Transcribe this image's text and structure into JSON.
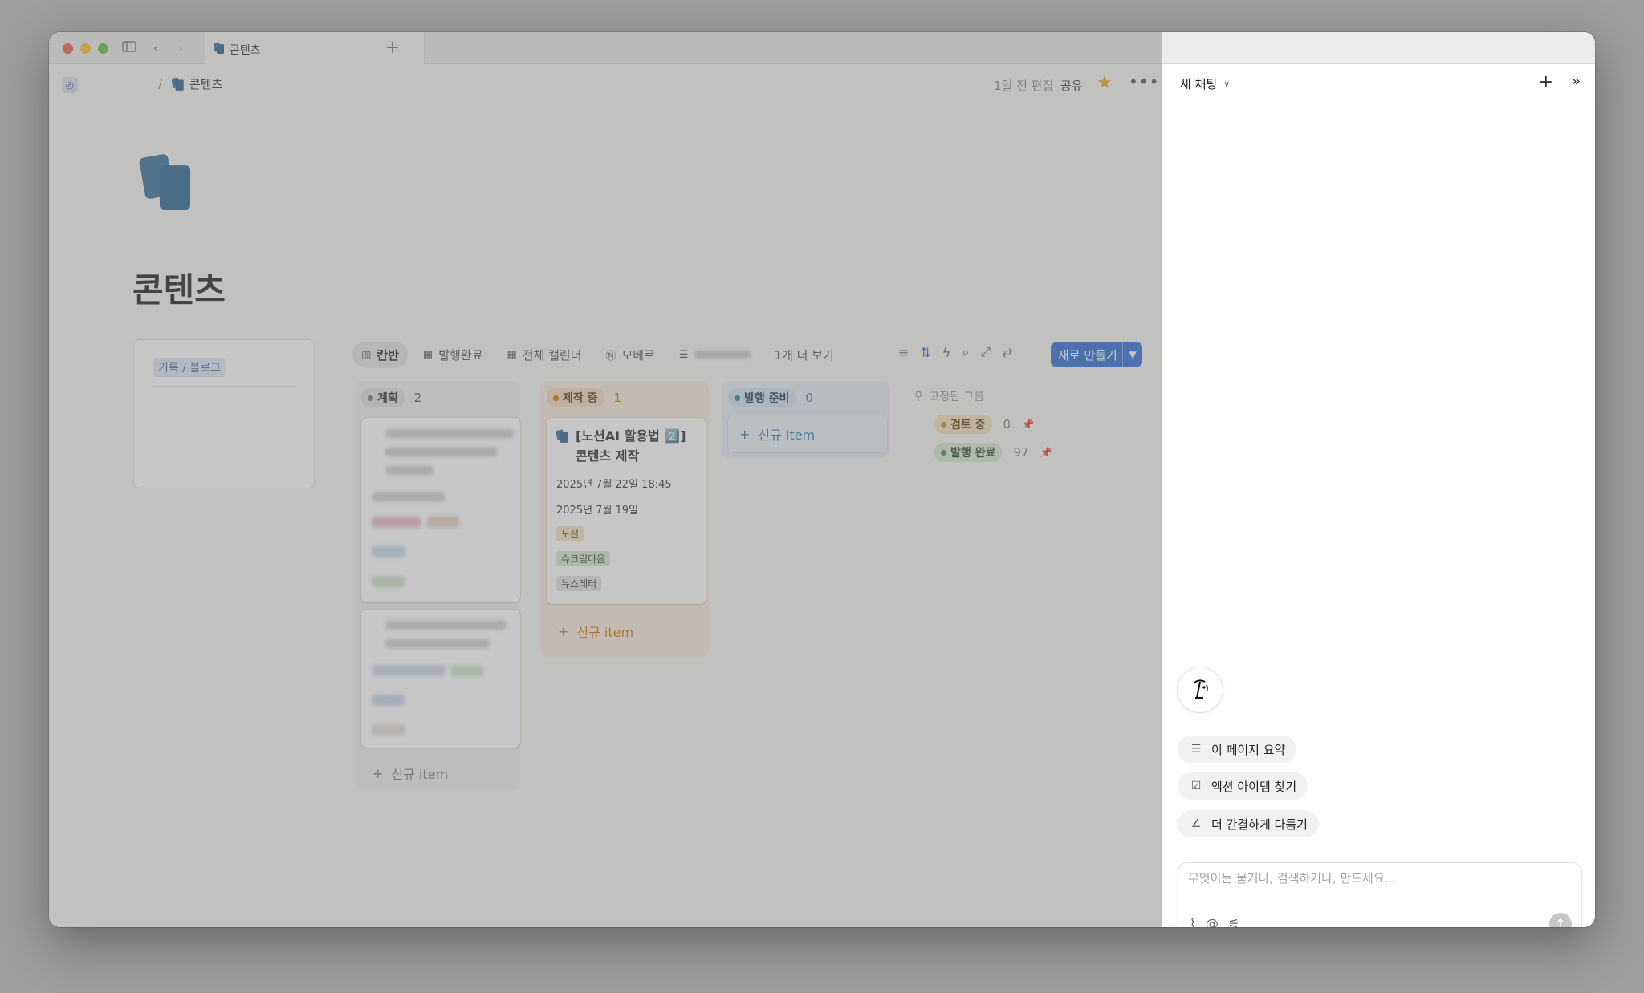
{
  "window": {
    "tab_title": "콘텐츠"
  },
  "topbar": {
    "breadcrumb_page": "콘텐츠",
    "edited": "1일 전 편집",
    "share": "공유"
  },
  "page": {
    "title": "콘텐츠",
    "sidecard_chip": "기록 / 블로그"
  },
  "views": {
    "tabs": [
      "칸반",
      "발행완료",
      "전체 캘린더",
      "모베르",
      "1개 더 보기"
    ],
    "new_button": "새로 만들기"
  },
  "columns": {
    "plan": {
      "label": "계획",
      "count": "2",
      "color": "#7a7a7a"
    },
    "prod": {
      "label": "제작 중",
      "count": "1",
      "color": "#d9730d"
    },
    "pub": {
      "label": "발행 준비",
      "count": "0",
      "color": "#337ea9"
    }
  },
  "card": {
    "title": "[노션AI 활용법 2️⃣] 콘텐츠 제작",
    "date1": "2025년 7월 22일 18:45",
    "date2": "2025년 7월 19일",
    "tags": [
      "노션",
      "슈크림마음",
      "뉴스레터"
    ]
  },
  "add_item_label": "신규 item",
  "pinned": {
    "header": "고정된 그룹",
    "rows": [
      {
        "label": "검토 중",
        "count": "0"
      },
      {
        "label": "발행 완료",
        "count": "97"
      }
    ]
  },
  "ai_panel": {
    "title": "새 채팅",
    "suggestions": [
      "이 페이지 요약",
      "액션 아이템 찾기",
      "더 간결하게 다듬기"
    ],
    "input_placeholder": "무엇이든 묻거나, 검색하거나, 만드세요..."
  }
}
